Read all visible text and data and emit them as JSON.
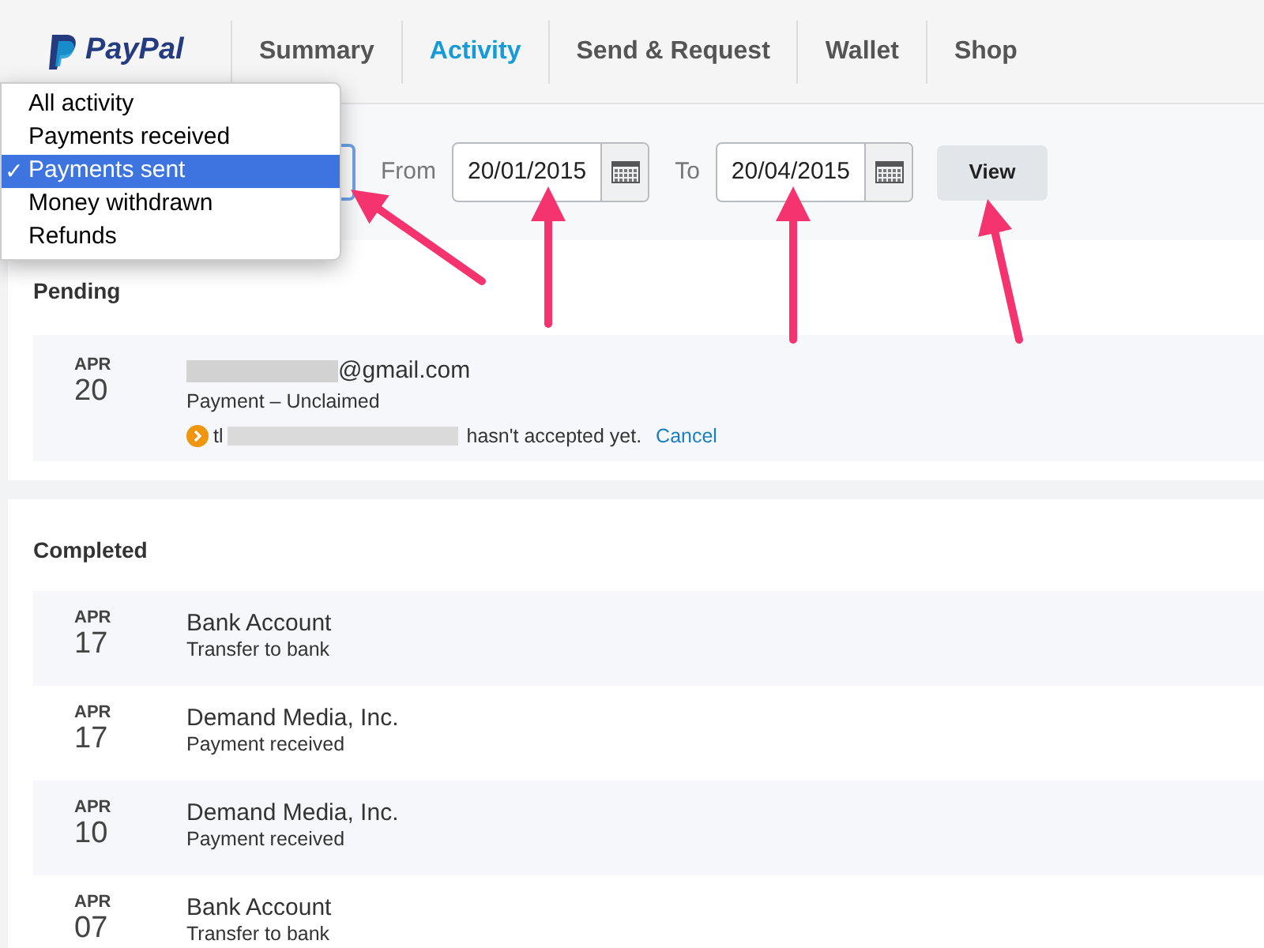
{
  "nav": {
    "logo": "PayPal",
    "tabs": [
      {
        "label": "Summary",
        "selected": false
      },
      {
        "label": "Activity",
        "selected": true
      },
      {
        "label": "Send & Request",
        "selected": false
      },
      {
        "label": "Wallet",
        "selected": false
      },
      {
        "label": "Shop",
        "selected": false
      }
    ]
  },
  "filter": {
    "menu": [
      {
        "label": "All activity",
        "selected": false
      },
      {
        "label": "Payments received",
        "selected": false
      },
      {
        "label": "Payments sent",
        "selected": true
      },
      {
        "label": "Money withdrawn",
        "selected": false
      },
      {
        "label": "Refunds",
        "selected": false
      }
    ],
    "check": "✓",
    "from_label": "From",
    "from_value": "20/01/2015",
    "to_label": "To",
    "to_value": "20/04/2015",
    "button": "View"
  },
  "pending": {
    "title": "Pending",
    "rows": [
      {
        "month": "APR",
        "day": "20",
        "email_visible": "@gmail.com",
        "subtitle": "Payment – Unclaimed",
        "notice_start": "tl",
        "notice_end": "hasn't accepted yet.",
        "link": "Cancel"
      }
    ]
  },
  "completed": {
    "title": "Completed",
    "rows": [
      {
        "month": "APR",
        "day": "17",
        "name": "Bank Account",
        "subtitle": "Transfer to bank"
      },
      {
        "month": "APR",
        "day": "17",
        "name": "Demand Media, Inc.",
        "subtitle": "Payment received"
      },
      {
        "month": "APR",
        "day": "10",
        "name": "Demand Media, Inc.",
        "subtitle": "Payment received"
      },
      {
        "month": "APR",
        "day": "07",
        "name": "Bank Account",
        "subtitle": "Transfer to bank"
      }
    ]
  }
}
